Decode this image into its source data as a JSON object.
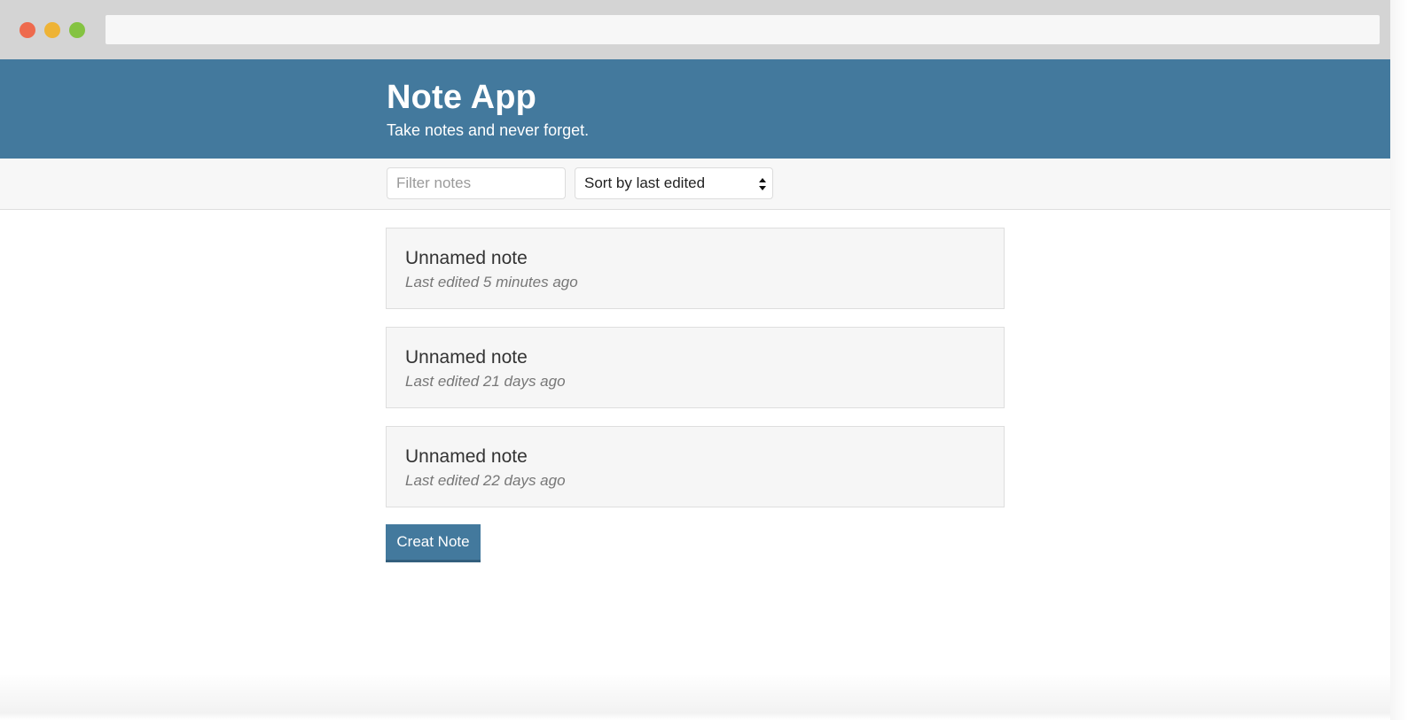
{
  "app": {
    "title": "Note App",
    "subtitle": "Take notes and never forget."
  },
  "toolbar": {
    "filter_placeholder": "Filter notes",
    "filter_value": "",
    "sort_selected": "Sort by last edited"
  },
  "notes": [
    {
      "title": "Unnamed note",
      "meta": "Last edited 5 minutes ago"
    },
    {
      "title": "Unnamed note",
      "meta": "Last edited 21 days ago"
    },
    {
      "title": "Unnamed note",
      "meta": "Last edited 22 days ago"
    }
  ],
  "actions": {
    "create_label": "Creat Note"
  },
  "colors": {
    "brand": "#43799d",
    "chrome": "#d4d4d4",
    "close": "#ee6a4d",
    "minimize": "#eeb336",
    "maximize": "#84c341"
  },
  "icons": {
    "sort": "sort-arrows-icon"
  }
}
